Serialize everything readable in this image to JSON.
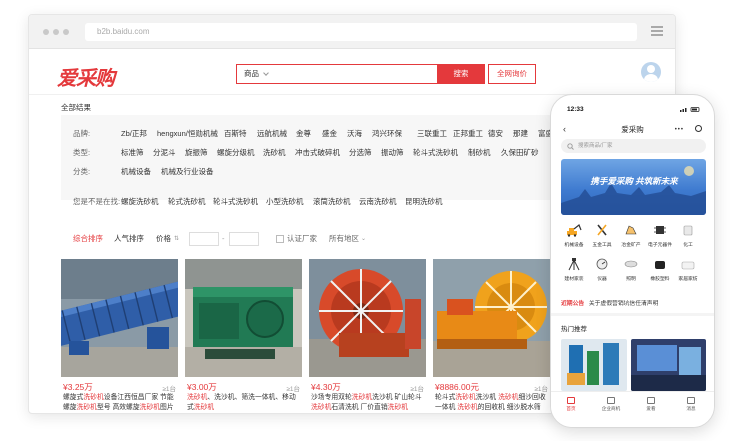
{
  "browser": {
    "address": "b2b.baidu.com"
  },
  "header": {
    "logo": "爱采购",
    "search_category": "商品",
    "search_button": "搜索",
    "quote_button": "全网询价"
  },
  "results_title": "全部结果",
  "filters": {
    "brand": {
      "label": "品牌:",
      "options": [
        "Zb/正邦",
        "hengxun/恒勋机械",
        "百斯特",
        "远航机械",
        "金尊",
        "盛金",
        "沃海",
        "鸿兴环保",
        "三联重工",
        "正邦重工",
        "德安",
        "那建",
        "富盛"
      ]
    },
    "type": {
      "label": "类型:",
      "options": [
        "标准筛",
        "分泥斗",
        "旋振筛",
        "螺旋分级机",
        "洗砂机",
        "冲击式破碎机",
        "分选筛",
        "振动筛",
        "轮斗式洗砂机",
        "制砂机",
        "久保田矿砂"
      ]
    },
    "category": {
      "label": "分类:",
      "options": [
        "机械设备",
        "机械及行业设备"
      ]
    },
    "also": {
      "label": "您是不是在找:",
      "options": [
        "螺旋洗砂机",
        "轮式洗砂机",
        "轮斗式洗砂机",
        "小型洗砂机",
        "滚筒洗砂机",
        "云南洗砂机",
        "昆明洗砂机"
      ]
    }
  },
  "sort": {
    "comprehensive": "综合排序",
    "popularity": "人气排序",
    "price": "价格",
    "price_sep": "-",
    "certified": "认证厂家",
    "region": "所有地区"
  },
  "products": [
    {
      "price": "¥3.25万",
      "moq": "≥1台",
      "desc_parts": [
        "螺旋式",
        "洗砂机",
        "设备江西恒昌厂家 节能螺旋",
        "洗砂机",
        "型号 高效螺旋",
        "洗砂机",
        "图片"
      ]
    },
    {
      "price": "¥3.00万",
      "moq": "≥1台",
      "desc_parts": [
        "洗砂机",
        "、洗沙机、筛洗一体机、移动式",
        "洗砂机",
        "",
        "",
        "",
        ""
      ]
    },
    {
      "price": "¥4.30万",
      "moq": "≥1台",
      "desc_parts": [
        "沙场专用双轮",
        "洗砂机",
        "洗沙机 矿山轮斗",
        "洗砂机",
        "石清洗机 厂价直销",
        "洗砂机",
        ""
      ]
    },
    {
      "price": "¥8886.00元",
      "moq": "≥1台",
      "desc_parts": [
        "轮斗式",
        "洗砂机",
        "洗沙机 ",
        "洗砂机",
        "细沙回收一体机 ",
        "洗砂机",
        "的回收机 细沙脱水筛"
      ]
    }
  ],
  "phone": {
    "time": "12:33",
    "title": "爱采购",
    "search_placeholder": "搜索商品/厂家",
    "banner_text": "携手爱采购 共筑新未来",
    "icons": [
      {
        "label": "机械设备",
        "icon": "excavator-icon"
      },
      {
        "label": "五金工具",
        "icon": "tools-icon"
      },
      {
        "label": "冶金矿产",
        "icon": "ore-icon"
      },
      {
        "label": "电子元器件",
        "icon": "chip-icon"
      },
      {
        "label": "化工",
        "icon": "chemical-icon"
      },
      {
        "label": "建材家装",
        "icon": "tripod-icon"
      },
      {
        "label": "仪器",
        "icon": "meter-icon"
      },
      {
        "label": "照明",
        "icon": "lamp-icon"
      },
      {
        "label": "橡胶塑料",
        "icon": "rubber-icon"
      },
      {
        "label": "家居家纺",
        "icon": "textile-icon"
      }
    ],
    "notice_tag": "近期公告",
    "notice_text": "关于虚假营销坑信任清声明",
    "hot_title": "热门推荐",
    "tabs": [
      "首页",
      "企业商机",
      "爱看",
      "消息"
    ]
  },
  "colors": {
    "accent": "#e4393c",
    "banner": "#3f7bd0"
  }
}
